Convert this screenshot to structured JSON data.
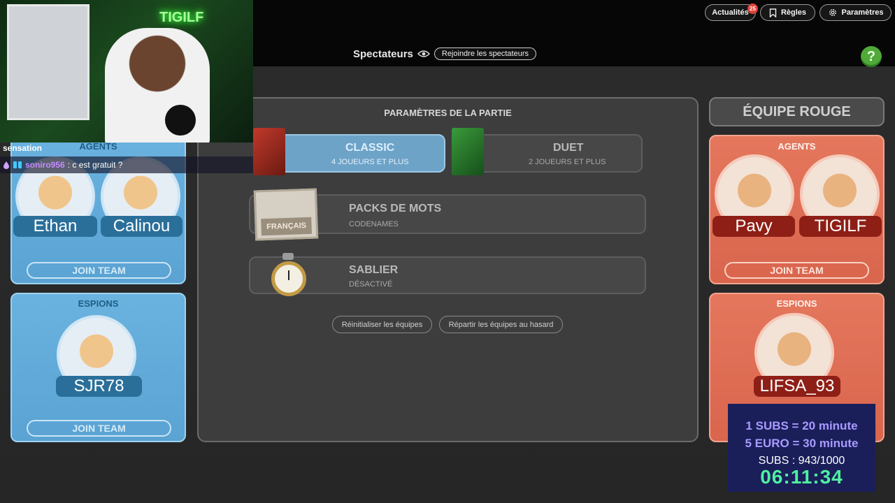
{
  "nav": {
    "news": {
      "label": "Actualités",
      "badge": "25"
    },
    "rules": {
      "label": "Règles"
    },
    "settings": {
      "label": "Paramètres"
    }
  },
  "help_label": "?",
  "spectators": {
    "title": "Spectateurs",
    "join_label": "Rejoindre les spectateurs"
  },
  "stream": {
    "neon_text": "TIGILF",
    "chat_label": "sensation",
    "chat_user": "soniro956",
    "chat_text": ": c est gratuit ?"
  },
  "blue_team": {
    "agents_title": "AGENTS",
    "agents": [
      "Ethan",
      "Calinou"
    ],
    "spies_title": "ESPIONS",
    "spies": [
      "SJR78"
    ],
    "join_label": "JOIN TEAM"
  },
  "red_team": {
    "header": "ÉQUIPE ROUGE",
    "agents_title": "AGENTS",
    "agents": [
      "Pavy",
      "TIGILF"
    ],
    "spies_title": "ESPIONS",
    "spies": [
      "LIFSA_93"
    ],
    "join_label": "JOIN TEAM"
  },
  "game_settings": {
    "title": "PARAMÈTRES DE LA PARTIE",
    "classic": {
      "label": "CLASSIC",
      "sub": "4 JOUEURS ET PLUS"
    },
    "duet": {
      "label": "DUET",
      "sub": "2 JOUEURS ET PLUS"
    },
    "word_packs": {
      "label": "PACKS DE MOTS",
      "sub": "CODENAMES",
      "card_label": "FRANÇAIS"
    },
    "timer": {
      "label": "SABLIER",
      "sub": "DÉSACTIVÉ"
    },
    "reset_teams": "Réinitialiser les équipes",
    "shuffle_teams": "Répartir les équipes au hasard"
  },
  "subathon": {
    "line1": "1 SUBS = 20 minute",
    "line2": "5 EURO = 30 minute",
    "count": "SUBS : 943/1000",
    "timer": "06:11:34"
  },
  "colors": {
    "blue_panel": "#5aa3d3",
    "red_panel": "#d9654d",
    "classic_selected": "#6ea3c8",
    "help_green": "#4faa39",
    "timer_green": "#4ff0a0"
  }
}
